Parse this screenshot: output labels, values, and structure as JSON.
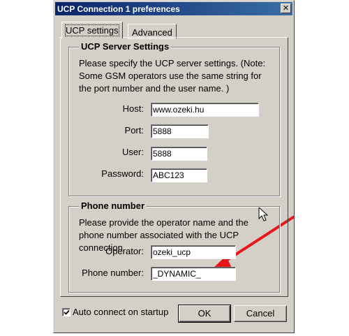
{
  "window": {
    "title": "UCP Connection 1 preferences",
    "close_glyph": "✕"
  },
  "tabs": [
    {
      "label": "UCP settings",
      "active": true
    },
    {
      "label": "Advanced",
      "active": false
    }
  ],
  "server_group": {
    "title": "UCP Server Settings",
    "description": "Please specify the UCP server settings. (Note: Some GSM operators use the same string for the port number and the user name. )",
    "host_label": "Host:",
    "host_value": "www.ozeki.hu",
    "port_label": "Port:",
    "port_value": "5888",
    "user_label": "User:",
    "user_value": "5888",
    "password_label": "Password:",
    "password_value": "ABC123"
  },
  "phone_group": {
    "title": "Phone number",
    "description": "Please provide the operator name and the phone number associated with the UCP connection",
    "operator_label": "Operator:",
    "operator_value": "ozeki_ucp",
    "phone_label": "Phone number:",
    "phone_value": "_DYNAMIC_"
  },
  "footer": {
    "auto_connect_label": "Auto connect on startup",
    "auto_connect_checked": true,
    "ok_label": "OK",
    "cancel_label": "Cancel"
  },
  "annotation": {
    "arrow_color": "#e8161b",
    "cursor_icon": "mouse-pointer-icon"
  }
}
